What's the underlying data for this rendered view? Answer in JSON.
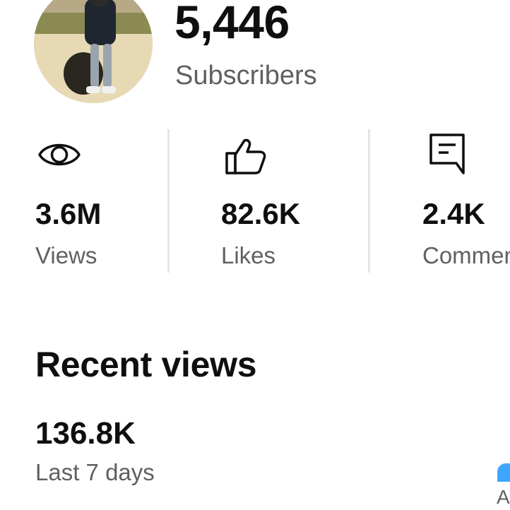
{
  "channel": {
    "subscriber_count": "5,446",
    "subscriber_label": "Subscribers"
  },
  "stats": [
    {
      "icon": "eye-icon",
      "value": "3.6M",
      "label": "Views"
    },
    {
      "icon": "thumbs-up-icon",
      "value": "82.6K",
      "label": "Likes"
    },
    {
      "icon": "comment-icon",
      "value": "2.4K",
      "label": "Comments"
    }
  ],
  "recent_views": {
    "title": "Recent views",
    "value": "136.8K",
    "period": "Last 7 days"
  },
  "edge": {
    "partial_label": "A",
    "accent_color": "#3ea6ff"
  }
}
